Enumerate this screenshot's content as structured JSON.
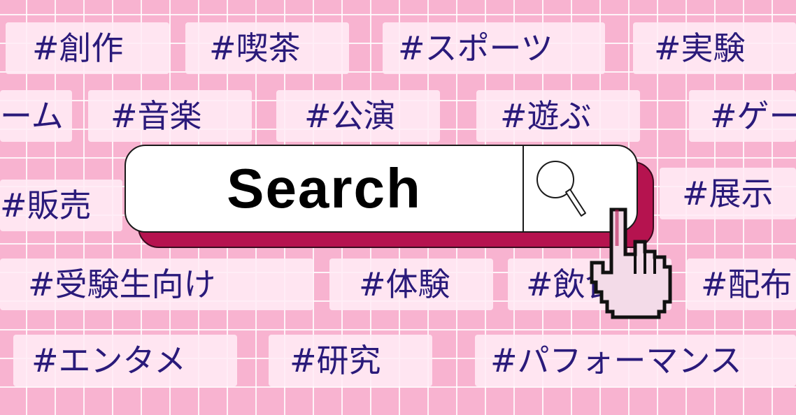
{
  "search": {
    "label": "Search"
  },
  "tags": [
    "#創作",
    "#喫茶",
    "#スポーツ",
    "#実験",
    "ーム",
    "#音楽",
    "#公演",
    "#遊ぶ",
    "#ゲー",
    "#販売",
    "#展示",
    "#受験生向け",
    "#体験",
    "#飲食",
    "#配布",
    "#エンタメ",
    "#研究",
    "#パフォーマンス"
  ],
  "colors": {
    "background": "#f8b3d0",
    "tag_background": "#ffecf5",
    "tag_text": "#2a1a7a",
    "search_shadow": "#b5134f",
    "cursor_fill": "#f3dbe8"
  }
}
